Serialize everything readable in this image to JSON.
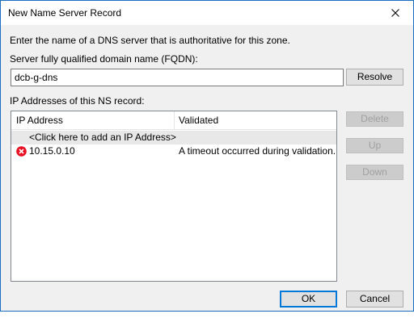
{
  "window": {
    "title": "New Name Server Record"
  },
  "instructions": "Enter the name of a DNS server that is authoritative for this zone.",
  "fqdn": {
    "label": "Server fully qualified domain name (FQDN):",
    "value": "dcb-g-dns"
  },
  "buttons": {
    "resolve": "Resolve",
    "delete": "Delete",
    "up": "Up",
    "down": "Down",
    "ok": "OK",
    "cancel": "Cancel"
  },
  "ip_section": {
    "label": "IP Addresses of this NS record:",
    "columns": [
      "IP Address",
      "Validated"
    ],
    "add_row_text": "<Click here to add an IP Address>",
    "rows": [
      {
        "icon": "error-icon",
        "ip": "10.15.0.10",
        "validated": "A timeout occurred during validation."
      }
    ]
  },
  "colors": {
    "accent": "#0078d7",
    "error": "#e81123"
  }
}
